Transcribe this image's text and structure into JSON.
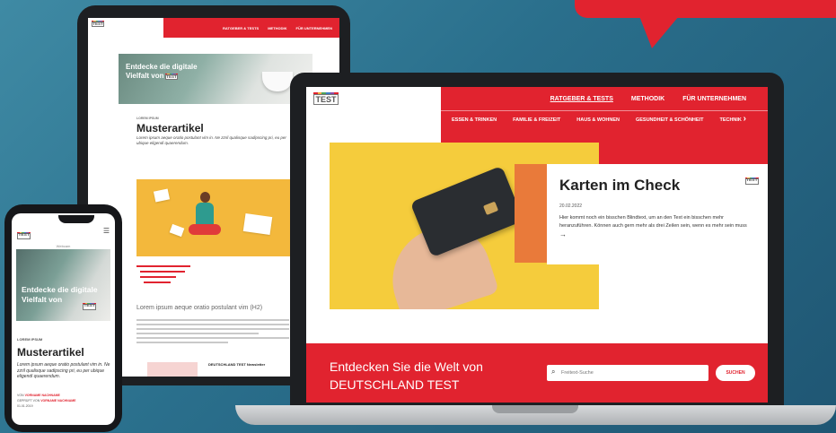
{
  "brand": {
    "logo_text": "TEST",
    "colors": {
      "primary": "#e1232f",
      "accent_orange": "#e97a3a",
      "accent_yellow": "#f5cc3c"
    },
    "stripe_colors": [
      "#e1232f",
      "#f3a73b",
      "#4aa35a",
      "#3b7cc4",
      "#8b4aa3",
      "#e1232f"
    ]
  },
  "tablet": {
    "nav": [
      "RATGEBER & TESTS",
      "METHODIK",
      "FÜR UNTERNEHMEN"
    ],
    "hero_title": "Entdecke die digitale Vielfalt von",
    "meta": "LOREM IPSUM",
    "title": "Musterartikel",
    "lead": "Lorem ipsum aeque oratio postulant vim in. Ne zzril qualisque sadipscing pri, eu per ubique eligendi quaerendum.",
    "h2": "Lorem ipsum aeque oratio postulant vim (H2)",
    "card_title": "DEUTSCHLAND TEST Newsletter"
  },
  "phone": {
    "breadcrumb": "Webcam",
    "hero_title": "Entdecke die digitale Vielfalt von",
    "category": "LOREM IPSUM",
    "title": "Musterartikel",
    "lead": "Lorem ipsum aeque oratio postulant vim in. Ne zzril qualisque sadipscing pri, eu per ubique eligendi quaerendum.",
    "author_prefix": "VON",
    "author_name": "VORNAME NACHNAME",
    "reviewed_prefix": "GEPRÜFT VON",
    "reviewer_name": "VORNAME NACHNAME",
    "date": "01.01.2019"
  },
  "laptop": {
    "top_nav": [
      "RATGEBER & TESTS",
      "METHODIK",
      "FÜR UNTERNEHMEN"
    ],
    "sub_nav": [
      "ESSEN & TRINKEN",
      "FAMILIE & FREIZEIT",
      "HAUS & WOHNEN",
      "GESUNDHEIT & SCHÖNHEIT",
      "TECHNIK"
    ],
    "hero_title": "Karten im Check",
    "hero_date": "20.02.2022",
    "hero_text": "Hier kommt noch ein bisschen Blindtext, um an den Text ein bisschen mehr heranzuführen. Können auch gern mehr als drei Zeilen sein, wenn es mehr sein muss",
    "slider_progress": 0.5,
    "explore_text": "Entdecken Sie die Welt von DEUTSCHLAND TEST",
    "search_placeholder": "Freitext-Suche",
    "search_button": "SUCHEN"
  },
  "icons": [
    "chevron-right-icon",
    "arrow-left-icon",
    "arrow-right-icon",
    "search-icon",
    "menu-icon",
    "arrow-right-small-icon"
  ]
}
